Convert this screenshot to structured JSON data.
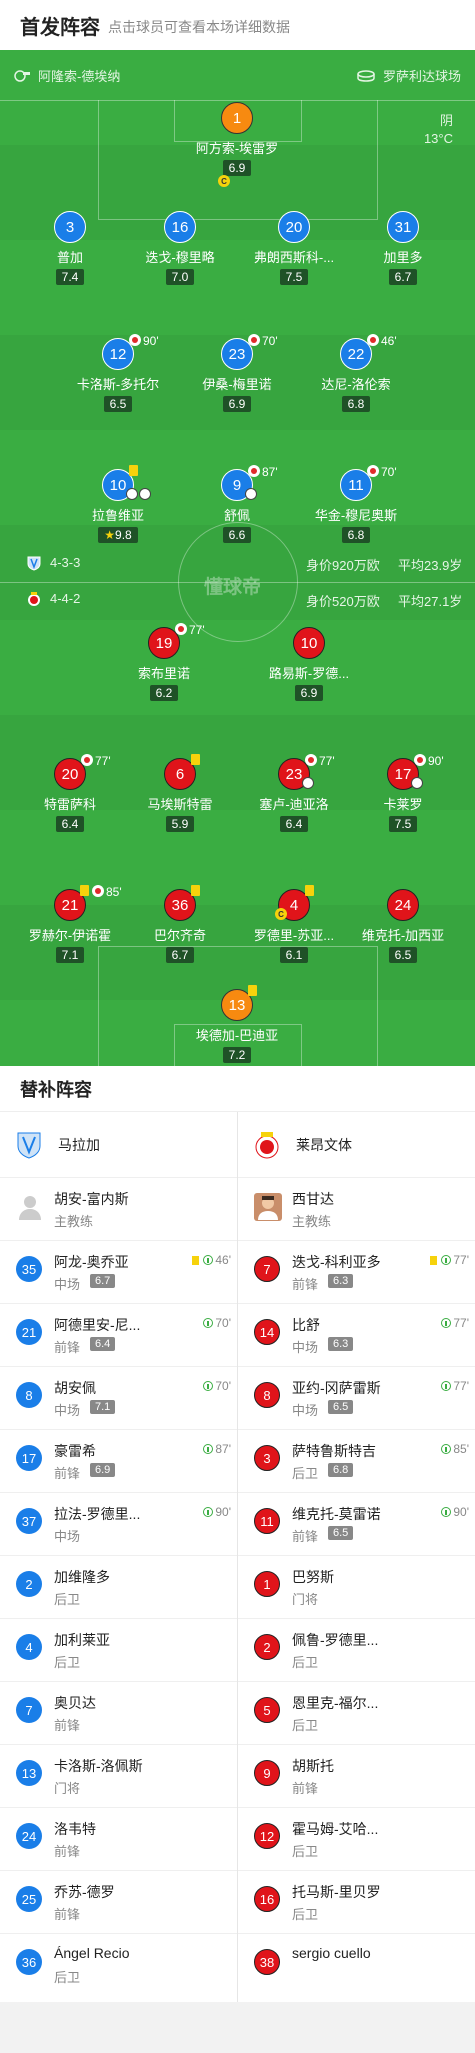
{
  "header": {
    "title": "首发阵容",
    "subtitle": "点击球员可查看本场详细数据"
  },
  "venue": {
    "left": "阿隆索-德埃纳",
    "right": "罗萨利达球场"
  },
  "weather": {
    "condition": "阴",
    "temp": "13°C"
  },
  "watermark": "懂球帝",
  "home_info": {
    "formation": "4-3-3",
    "value": "身价920万欧",
    "age": "平均23.9岁"
  },
  "away_info": {
    "formation": "4-4-2",
    "value": "身价520万欧",
    "age": "平均27.1岁"
  },
  "home_players": [
    {
      "num": "1",
      "name": "阿方索-埃雷罗",
      "rating": "6.9"
    },
    {
      "num": "3",
      "name": "普加",
      "rating": "7.4"
    },
    {
      "num": "16",
      "name": "迭戈-穆里略",
      "rating": "7.0"
    },
    {
      "num": "20",
      "name": "弗朗西斯科-...",
      "rating": "7.5"
    },
    {
      "num": "31",
      "name": "加里多",
      "rating": "6.7"
    },
    {
      "num": "12",
      "name": "卡洛斯-多托尔",
      "rating": "6.5",
      "sub": "90'"
    },
    {
      "num": "23",
      "name": "伊桑-梅里诺",
      "rating": "6.9",
      "sub": "70'"
    },
    {
      "num": "22",
      "name": "达尼-洛伦索",
      "rating": "6.8",
      "sub": "46'"
    },
    {
      "num": "10",
      "name": "拉鲁维亚",
      "rating": "9.8"
    },
    {
      "num": "9",
      "name": "舒佩",
      "rating": "6.6",
      "sub": "87'"
    },
    {
      "num": "11",
      "name": "华金-穆尼奥斯",
      "rating": "6.8",
      "sub": "70'"
    }
  ],
  "away_players": [
    {
      "num": "19",
      "name": "索布里诺",
      "rating": "6.2",
      "sub": "77'"
    },
    {
      "num": "10",
      "name": "路易斯-罗德...",
      "rating": "6.9"
    },
    {
      "num": "20",
      "name": "特雷萨科",
      "rating": "6.4",
      "sub": "77'"
    },
    {
      "num": "6",
      "name": "马埃斯特雷",
      "rating": "5.9"
    },
    {
      "num": "23",
      "name": "塞卢-迪亚洛",
      "rating": "6.4",
      "sub": "77'"
    },
    {
      "num": "17",
      "name": "卡莱罗",
      "rating": "7.5",
      "sub": "90'"
    },
    {
      "num": "21",
      "name": "罗赫尔-伊诺霍",
      "rating": "7.1",
      "sub": "85'"
    },
    {
      "num": "36",
      "name": "巴尔齐奇",
      "rating": "6.7"
    },
    {
      "num": "4",
      "name": "罗德里-苏亚...",
      "rating": "6.1"
    },
    {
      "num": "24",
      "name": "维克托-加西亚",
      "rating": "6.5"
    },
    {
      "num": "13",
      "name": "埃德加-巴迪亚",
      "rating": "7.2"
    }
  ],
  "subs": {
    "title": "替补阵容",
    "home_team": "马拉加",
    "away_team": "莱昂文体",
    "home_coach": {
      "name": "胡安-富内斯",
      "role": "主教练"
    },
    "away_coach": {
      "name": "西甘达",
      "role": "主教练"
    },
    "home": [
      {
        "num": "35",
        "name": "阿龙-奥乔亚",
        "pos": "中场",
        "rating": "6.7",
        "time": "46'"
      },
      {
        "num": "21",
        "name": "阿德里安-尼...",
        "pos": "前锋",
        "rating": "6.4",
        "time": "70'"
      },
      {
        "num": "8",
        "name": "胡安佩",
        "pos": "中场",
        "rating": "7.1",
        "time": "70'"
      },
      {
        "num": "17",
        "name": "豪雷希",
        "pos": "前锋",
        "rating": "6.9",
        "time": "87'"
      },
      {
        "num": "37",
        "name": "拉法-罗德里...",
        "pos": "中场",
        "time": "90'"
      },
      {
        "num": "2",
        "name": "加维隆多",
        "pos": "后卫"
      },
      {
        "num": "4",
        "name": "加利莱亚",
        "pos": "后卫"
      },
      {
        "num": "7",
        "name": "奥贝达",
        "pos": "前锋"
      },
      {
        "num": "13",
        "name": "卡洛斯-洛佩斯",
        "pos": "门将"
      },
      {
        "num": "24",
        "name": "洛韦特",
        "pos": "前锋"
      },
      {
        "num": "25",
        "name": "乔苏-德罗",
        "pos": "前锋"
      },
      {
        "num": "36",
        "name": "Ángel Recio",
        "pos": "后卫"
      }
    ],
    "away": [
      {
        "num": "7",
        "name": "迭戈-科利亚多",
        "pos": "前锋",
        "rating": "6.3",
        "time": "77'"
      },
      {
        "num": "14",
        "name": "比舒",
        "pos": "中场",
        "rating": "6.3",
        "time": "77'"
      },
      {
        "num": "8",
        "name": "亚约-冈萨雷斯",
        "pos": "中场",
        "rating": "6.5",
        "time": "77'"
      },
      {
        "num": "3",
        "name": "萨特鲁斯特吉",
        "pos": "后卫",
        "rating": "6.8",
        "time": "85'"
      },
      {
        "num": "11",
        "name": "维克托-莫雷诺",
        "pos": "前锋",
        "rating": "6.5",
        "time": "90'"
      },
      {
        "num": "1",
        "name": "巴努斯",
        "pos": "门将"
      },
      {
        "num": "2",
        "name": "佩鲁-罗德里...",
        "pos": "后卫"
      },
      {
        "num": "5",
        "name": "恩里克-福尔...",
        "pos": "后卫"
      },
      {
        "num": "9",
        "name": "胡斯托",
        "pos": "前锋"
      },
      {
        "num": "12",
        "name": "霍马姆-艾哈...",
        "pos": "后卫"
      },
      {
        "num": "16",
        "name": "托马斯-里贝罗",
        "pos": "后卫"
      },
      {
        "num": "38",
        "name": "sergio cuello",
        "pos": ""
      }
    ]
  },
  "colors": {
    "pitch": "#37a53f",
    "home": "#1a7ee8",
    "away": "#e0141a",
    "rating_bg": "#1f5227"
  }
}
